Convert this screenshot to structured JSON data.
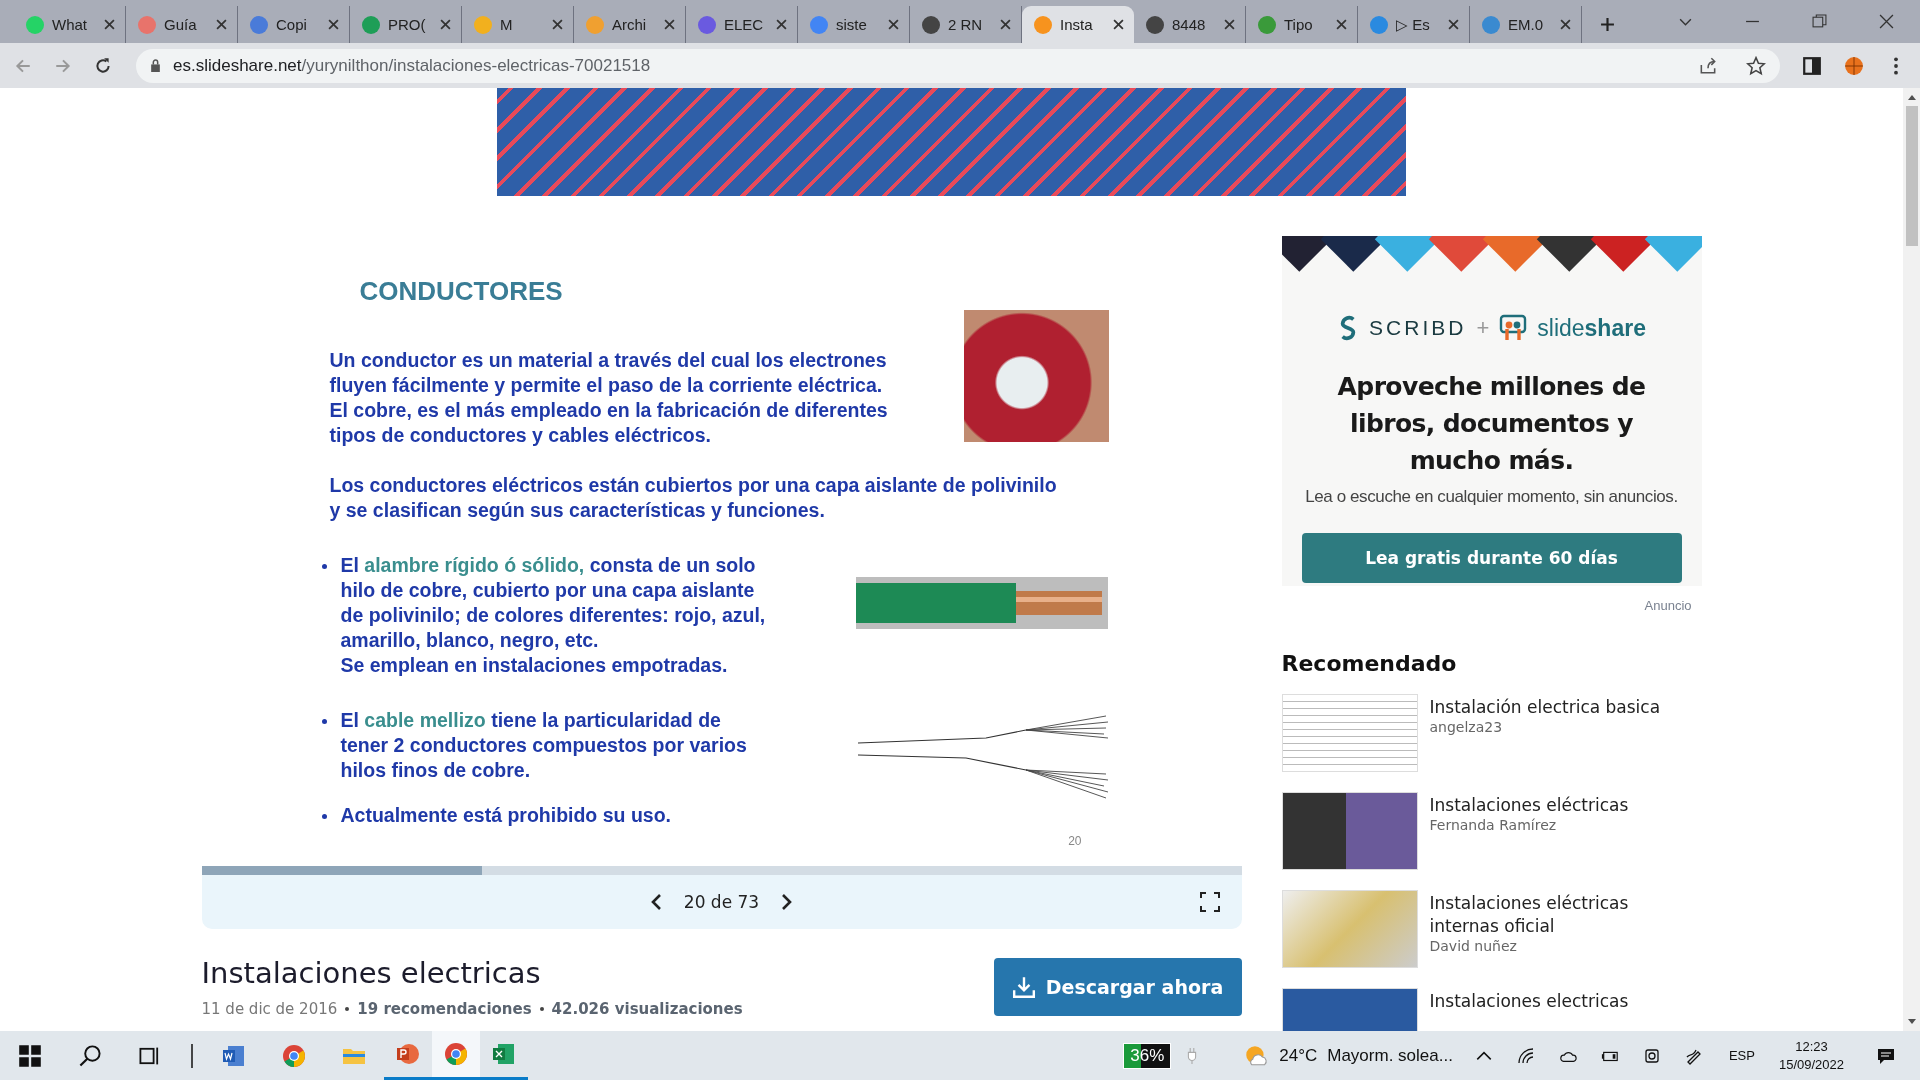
{
  "browser": {
    "tabs": [
      {
        "label": "What",
        "selected": false
      },
      {
        "label": "Guía",
        "selected": false
      },
      {
        "label": "Copi",
        "selected": false
      },
      {
        "label": "PRO(",
        "selected": false
      },
      {
        "label": "M",
        "selected": false
      },
      {
        "label": "Archi",
        "selected": false
      },
      {
        "label": "ELEC",
        "selected": false
      },
      {
        "label": "siste",
        "selected": false
      },
      {
        "label": "2 RN",
        "selected": false
      },
      {
        "label": "Insta",
        "selected": true
      },
      {
        "label": "8448",
        "selected": false
      },
      {
        "label": "Tipo",
        "selected": false
      },
      {
        "label": "▷ Es",
        "selected": false
      },
      {
        "label": "EM.0",
        "selected": false
      }
    ],
    "url": {
      "domain": "es.slideshare.net",
      "path": "/yurynilthon/instalaciones-electricas-70021518"
    }
  },
  "slide": {
    "title": "CONDUCTORES",
    "paragraphs": [
      "Un conductor es un material a través del cual los electrones\n fluyen fácilmente y permite el paso de la corriente eléctrica.\nEl cobre, es el más empleado en la fabricación de diferentes\ntipos de conductores y cables eléctricos.",
      "Los conductores eléctricos están cubiertos por una capa aislante de polivinilo\ny se clasifican según sus características y funciones."
    ],
    "bullets": [
      {
        "segments": [
          {
            "text": "El ",
            "highlight": false
          },
          {
            "text": "alambre rígido ó sólido,",
            "highlight": true
          },
          {
            "text": " consta de un solo\n hilo de  cobre, cubierto por una capa aislante\nde polivinilo; de colores diferentes: rojo, azul,\n amarillo, blanco, negro, etc.\n Se emplean en instalaciones empotradas.",
            "highlight": false
          }
        ]
      },
      {
        "segments": [
          {
            "text": "El  ",
            "highlight": false
          },
          {
            "text": "cable mellizo",
            "highlight": true
          },
          {
            "text": " tiene la particularidad de\ntener 2 conductores compuestos por varios\nhilos finos de cobre.",
            "highlight": false
          }
        ]
      },
      {
        "segments": [
          {
            "text": "Actualmente está prohibido su uso.",
            "highlight": false
          }
        ]
      }
    ],
    "page_number": "20"
  },
  "viewer": {
    "progress": {
      "level": 0.27
    },
    "counter": "20 de 73"
  },
  "document": {
    "title": "Instalaciones electricas",
    "date": "11 de dic de 2016",
    "recommendations": "19 recomendaciones",
    "views": "42.026 visualizaciones",
    "download_button": "Descargar ahora"
  },
  "sidebar": {
    "ad": {
      "brand_left": "SCRIBD",
      "plus": "+",
      "brand_right": "slide**share**",
      "headline": "Aproveche millones de libros, documentos y mucho más.",
      "subtitle": "Lea o escuche en cualquier momento, sin anuncios.",
      "button": "Lea gratis durante 60 días",
      "label": "Anuncio"
    },
    "recommended": {
      "heading": "Recomendado",
      "items": [
        {
          "title": "Instalación electrica basica",
          "author": "angelza23"
        },
        {
          "title": "Instalaciones eléctricas",
          "author": "Fernanda Ramírez"
        },
        {
          "title": "Instalaciones eléctricas internas oficial",
          "author": "David nuñez"
        },
        {
          "title": "Instalaciones electricas"
        }
      ]
    }
  },
  "taskbar": {
    "battery": "36%",
    "temperature": "24°C",
    "weather": "Mayorm. solea...",
    "language": "ESP",
    "time": "12:23",
    "date": "15/09/2022"
  }
}
